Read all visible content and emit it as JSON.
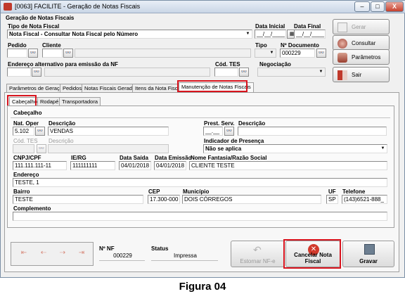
{
  "window": {
    "title": "[0063] FACILITE - Geração de Notas Fiscais",
    "minimize": "–",
    "maximize": "□",
    "close": "X"
  },
  "top": {
    "section_title": "Geração de Notas Fiscais",
    "tipo_label": "Tipo de Nota Fiscal",
    "tipo_value": "Nota Fiscal - Consultar Nota Fiscal pelo Número",
    "data_inicial_label": "Data Inicial",
    "data_inicial_value": "__/__/____",
    "data_final_label": "Data Final",
    "data_final_value": "__/__/____",
    "pedido_label": "Pedido",
    "cliente_label": "Cliente",
    "tipo2_label": "Tipo",
    "numdoc_label": "Nº Documento",
    "numdoc_value": "000229",
    "endereco_label": "Endereço alternativo para emissão da NF",
    "codtes_label": "Cód. TES",
    "negociacao_label": "Negociação"
  },
  "side_buttons": {
    "gerar": "Gerar",
    "consultar": "Consultar",
    "parametros": "Parâmetros",
    "sair": "Sair"
  },
  "tabs": [
    "Parâmetros de Geração",
    "Pedidos",
    "Notas Fiscais Geradas",
    "Itens da Nota Fiscal",
    "Manutenção de Notas Fiscais"
  ],
  "subtabs": [
    "Cabeçalho",
    "Rodapé",
    "Transportadora"
  ],
  "cabecalho": {
    "group_title": "Cabeçalho",
    "nat_oper_label": "Nat. Oper",
    "nat_oper_value": "5.102",
    "descricao_label": "Descrição",
    "descricao_value": "VENDAS",
    "prest_serv_label": "Prest. Serv.",
    "prest_serv_value": "__.__",
    "descricao2_label": "Descrição",
    "cod_tes_label": "Cód. TES",
    "descricao3_label": "Descrição",
    "indicador_label": "Indicador de Presença",
    "indicador_value": "Não se aplica",
    "cnpj_label": "CNPJ/CPF",
    "cnpj_value": "111.111.111-11",
    "ie_label": "IE/RG",
    "ie_value": "111111111",
    "data_saida_label": "Data Saída",
    "data_saida_value": "04/01/2018",
    "data_emissao_label": "Data Emissão",
    "data_emissao_value": "04/01/2018",
    "nome_label": "Nome Fantasia/Razão Social",
    "nome_value": "CLIENTE TESTE",
    "endereco_label": "Endereço",
    "endereco_value": "TESTE, 1",
    "bairro_label": "Bairro",
    "bairro_value": "TESTE",
    "cep_label": "CEP",
    "cep_value": "17.300-000",
    "municipio_label": "Município",
    "municipio_value": "DOIS CÓRREGOS",
    "uf_label": "UF",
    "uf_value": "SP",
    "telefone_label": "Telefone",
    "telefone_value": "(143)6521-888_",
    "complemento_label": "Complemento"
  },
  "footer": {
    "nav": [
      "⇤",
      "⇠",
      "⇢",
      "⇥"
    ],
    "num_nf_label": "Nº NF",
    "num_nf_value": "000229",
    "status_label": "Status",
    "status_value": "Impressa",
    "estornar": "Estornar NF-e",
    "cancelar": "Cancelar Nota Fiscal",
    "gravar": "Gravar"
  },
  "caption": "Figura 04",
  "colors": {
    "highlight": "#d8141e",
    "accent": "#c0392b"
  }
}
